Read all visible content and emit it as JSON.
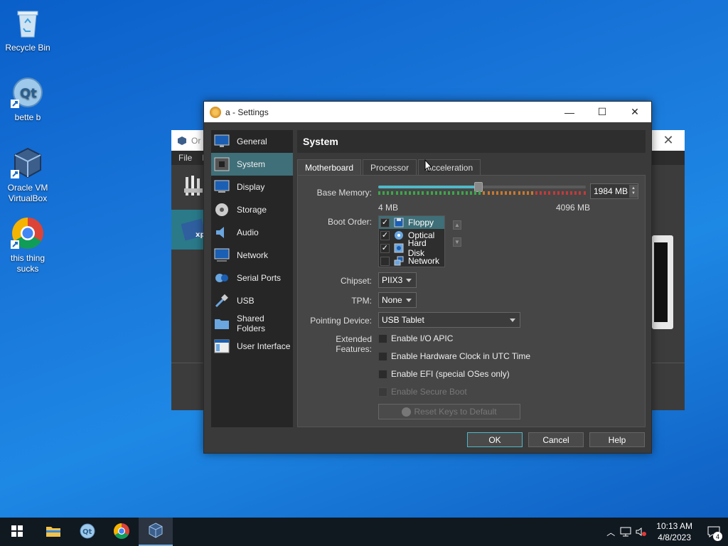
{
  "desktop": {
    "icons": [
      {
        "label": "Recycle Bin",
        "icon": "recycle-bin-icon"
      },
      {
        "label": "bette b",
        "icon": "qt-creator-icon"
      },
      {
        "label": "Oracle VM VirtualBox",
        "icon": "virtualbox-icon"
      },
      {
        "label": "this thing sucks",
        "icon": "chrome-icon"
      }
    ]
  },
  "bg_window": {
    "title": "Or",
    "menu": [
      "File",
      "M"
    ]
  },
  "dialog": {
    "title": "a - Settings",
    "sidebar": [
      {
        "label": "General",
        "icon": "general-icon"
      },
      {
        "label": "System",
        "icon": "system-icon",
        "active": true
      },
      {
        "label": "Display",
        "icon": "display-icon"
      },
      {
        "label": "Storage",
        "icon": "storage-icon"
      },
      {
        "label": "Audio",
        "icon": "audio-icon"
      },
      {
        "label": "Network",
        "icon": "network-icon"
      },
      {
        "label": "Serial Ports",
        "icon": "serial-ports-icon"
      },
      {
        "label": "USB",
        "icon": "usb-icon"
      },
      {
        "label": "Shared Folders",
        "icon": "shared-folders-icon"
      },
      {
        "label": "User Interface",
        "icon": "user-interface-icon"
      }
    ],
    "section_title": "System",
    "tabs": [
      {
        "label": "Motherboard",
        "active": true
      },
      {
        "label": "Processor"
      },
      {
        "label": "Acceleration"
      }
    ],
    "motherboard": {
      "base_memory_label": "Base Memory:",
      "base_memory_value": "1984 MB",
      "base_memory_fraction": 0.484,
      "memory_min": "4 MB",
      "memory_max": "4096 MB",
      "boot_order_label": "Boot Order:",
      "boot_order": [
        {
          "label": "Floppy",
          "checked": true,
          "icon": "floppy-icon",
          "selected": true
        },
        {
          "label": "Optical",
          "checked": true,
          "icon": "optical-disc-icon"
        },
        {
          "label": "Hard Disk",
          "checked": true,
          "icon": "hard-disk-icon"
        },
        {
          "label": "Network",
          "checked": false,
          "icon": "network-boot-icon"
        }
      ],
      "chipset_label": "Chipset:",
      "chipset_value": "PIIX3",
      "tpm_label": "TPM:",
      "tpm_value": "None",
      "pointing_label": "Pointing Device:",
      "pointing_value": "USB Tablet",
      "extended_label": "Extended Features:",
      "features": [
        {
          "label": "Enable I/O APIC",
          "enabled": true
        },
        {
          "label": "Enable Hardware Clock in UTC Time",
          "enabled": true
        },
        {
          "label": "Enable EFI (special OSes only)",
          "enabled": true
        },
        {
          "label": "Enable Secure Boot",
          "enabled": false
        }
      ],
      "reset_keys_label": "Reset Keys to Default"
    },
    "buttons": {
      "ok": "OK",
      "cancel": "Cancel",
      "help": "Help"
    }
  },
  "taskbar": {
    "time": "10:13 AM",
    "date": "4/8/2023",
    "notification_count": "4"
  }
}
